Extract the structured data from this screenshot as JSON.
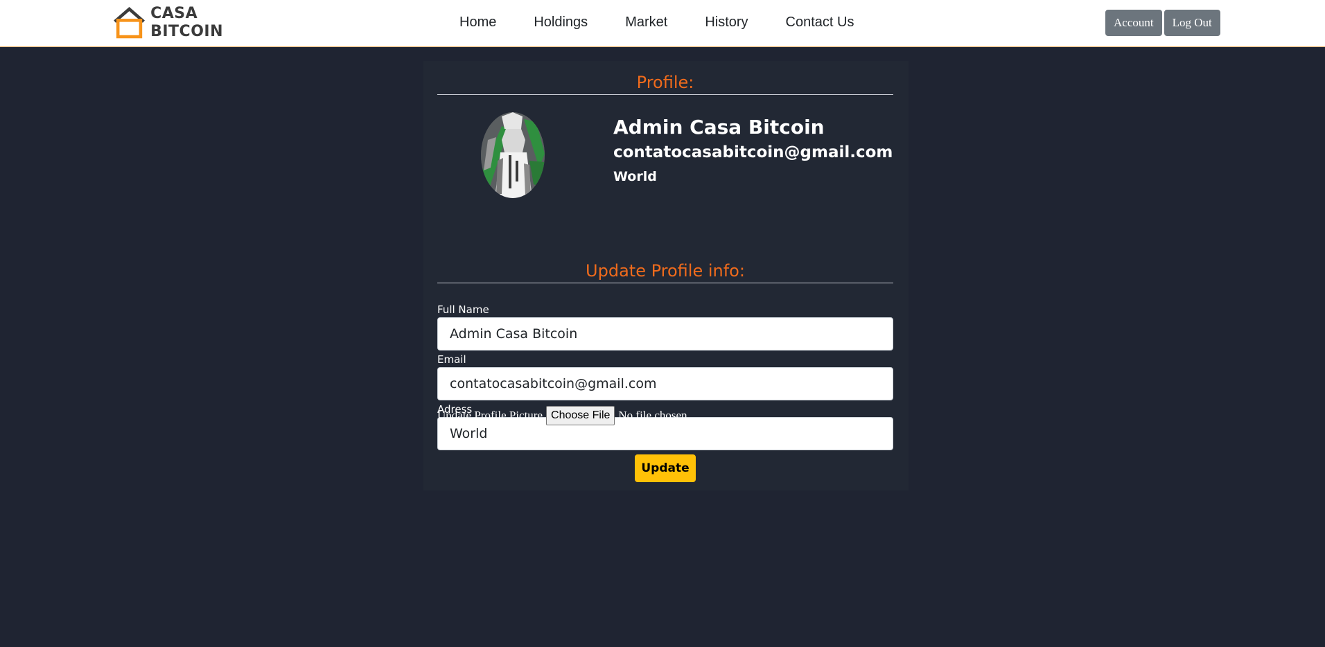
{
  "brand": {
    "line1": "CASA",
    "line2": "BITCOIN",
    "accent_color": "#f7931a"
  },
  "nav": {
    "links": [
      "Home",
      "Holdings",
      "Market",
      "History",
      "Contact Us"
    ],
    "account_label": "Account",
    "logout_label": "Log Out"
  },
  "profile": {
    "section_title": "Profile:",
    "name": "Admin Casa Bitcoin",
    "email": "contatocasabitcoin@gmail.com",
    "address": "World"
  },
  "update_form": {
    "section_title": "Update Profile info:",
    "full_name_label": "Full Name",
    "full_name_value": "Admin Casa Bitcoin",
    "email_label": "Email",
    "email_value": "contatocasabitcoin@gmail.com",
    "address_label": "Adress",
    "address_value": "World",
    "picture_label": "Update Profile Picture",
    "choose_file_label": "Choose File",
    "file_status": "No file chosen",
    "submit_label": "Update"
  },
  "colors": {
    "page_background": "#1f2432",
    "card_background": "#222834",
    "heading_orange": "#f06b1c",
    "update_button": "#ffc107",
    "nav_button": "#6c757d"
  }
}
